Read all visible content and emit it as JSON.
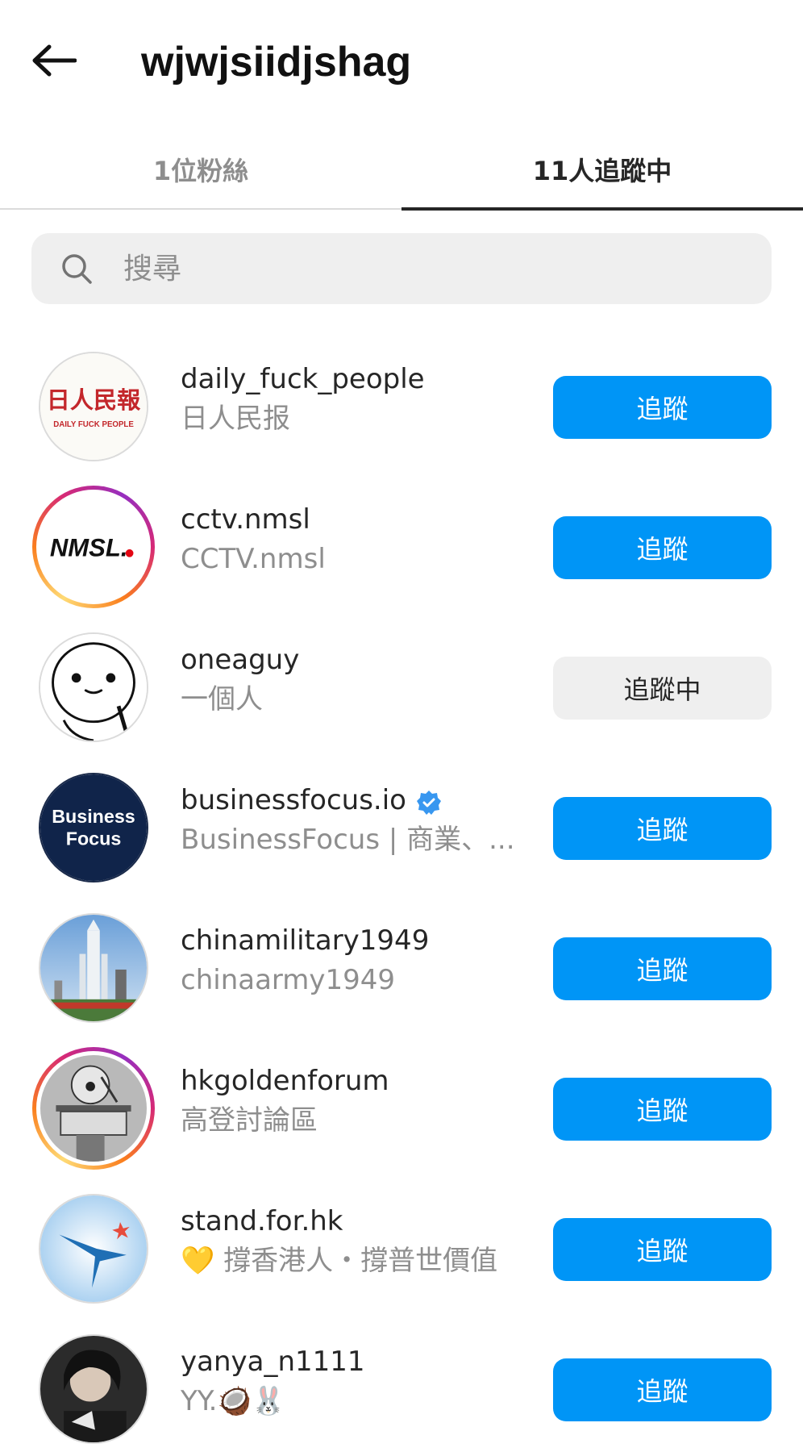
{
  "header": {
    "title": "wjwjsiidjshag"
  },
  "tabs": {
    "followers": "1位粉絲",
    "following": "11人追蹤中"
  },
  "search": {
    "placeholder": "搜尋"
  },
  "colors": {
    "primary_button": "#0095f6",
    "secondary_button": "#efefef",
    "secondary_text": "#8e8e8e"
  },
  "users": [
    {
      "username": "daily_fuck_people",
      "fullname": "日人民报",
      "button": "追蹤",
      "avatar_text": "日人民報",
      "avatar_subtext": "DAILY FUCK PEOPLE"
    },
    {
      "username": "cctv.nmsl",
      "fullname": "CCTV.nmsl",
      "button": "追蹤",
      "avatar_text": "NMSL."
    },
    {
      "username": "oneaguy",
      "fullname": "一個人",
      "button": "追蹤中"
    },
    {
      "username": "businessfocus.io",
      "fullname": "BusinessFocus | 商業、...",
      "button": "追蹤",
      "avatar_text": "Business",
      "avatar_subtext": "Focus"
    },
    {
      "username": "chinamilitary1949",
      "fullname": "chinaarmy1949",
      "button": "追蹤"
    },
    {
      "username": "hkgoldenforum",
      "fullname": "高登討論區",
      "button": "追蹤"
    },
    {
      "username": "stand.for.hk",
      "fullname": "💛 撐香港人・撐普世價值",
      "button": "追蹤"
    },
    {
      "username": "yanya_n1111",
      "fullname": "YY.🥥🐰",
      "button": "追蹤"
    }
  ]
}
